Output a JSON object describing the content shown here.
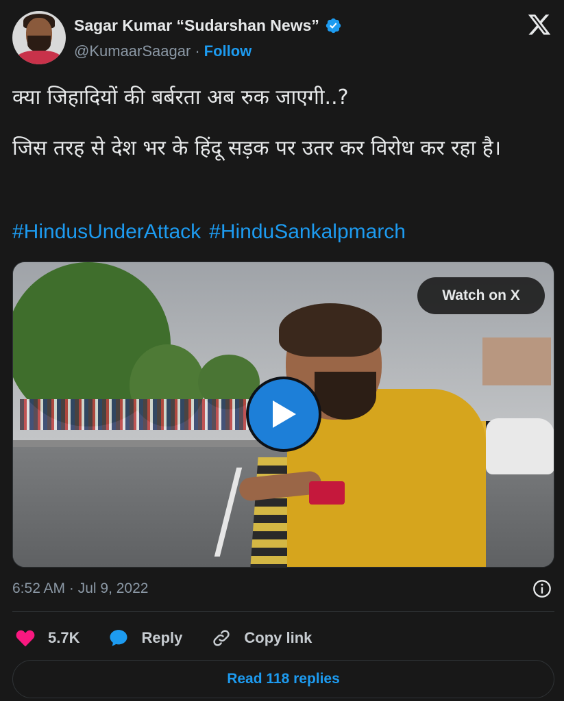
{
  "author": {
    "name": "Sagar Kumar “Sudarshan News”",
    "handle": "@KumaarSaagar",
    "separator": "·",
    "follow_label": "Follow"
  },
  "tweet": {
    "paragraphs": [
      "क्या जिहादियों की बर्बरता अब रुक जाएगी..?",
      "जिस तरह से देश भर के हिंदू सड़क पर उतर कर विरोध कर रहा है।"
    ],
    "hashtags": [
      "#HindusUnderAttack",
      "#HinduSankalpmarch"
    ]
  },
  "media": {
    "watch_label": "Watch on X",
    "play_icon": "play-icon"
  },
  "meta": {
    "timestamp": "6:52 AM · Jul 9, 2022"
  },
  "actions": {
    "likes": "5.7K",
    "reply_label": "Reply",
    "copy_label": "Copy link"
  },
  "footer": {
    "read_replies_label": "Read 118 replies"
  },
  "colors": {
    "accent": "#1d9bf0",
    "heart": "#f91880",
    "background": "#181818"
  }
}
